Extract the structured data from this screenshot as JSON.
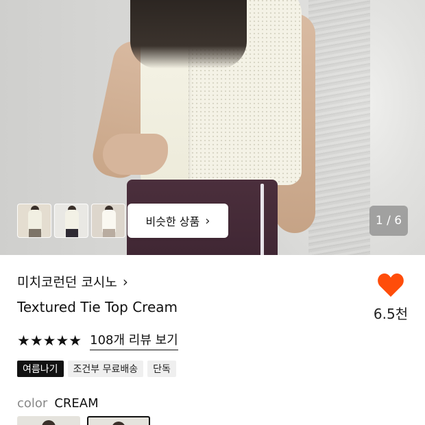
{
  "gallery": {
    "similar_button_label": "비슷한 상품",
    "counter": "1 / 6",
    "thumbnails": [
      "thumbnail-1",
      "thumbnail-2",
      "thumbnail-3"
    ]
  },
  "product": {
    "brand": "미치코런던 코시노",
    "title": "Textured Tie Top Cream",
    "likes": "6.5천",
    "rating_stars": "★★★★★",
    "review_link": "108개 리뷰 보기",
    "tags": [
      "여름나기",
      "조건부 무료배송",
      "단독"
    ],
    "color_label": "color",
    "color_value": "CREAM"
  },
  "colors": {
    "accent_heart": "#ff4d0a",
    "tag_dark_bg": "#111111",
    "tag_bg": "#efefef"
  },
  "icons": {
    "brand_chevron": "chevron-right-icon",
    "similar_chevron": "chevron-right-icon",
    "like": "heart-icon",
    "star": "star-icon"
  }
}
